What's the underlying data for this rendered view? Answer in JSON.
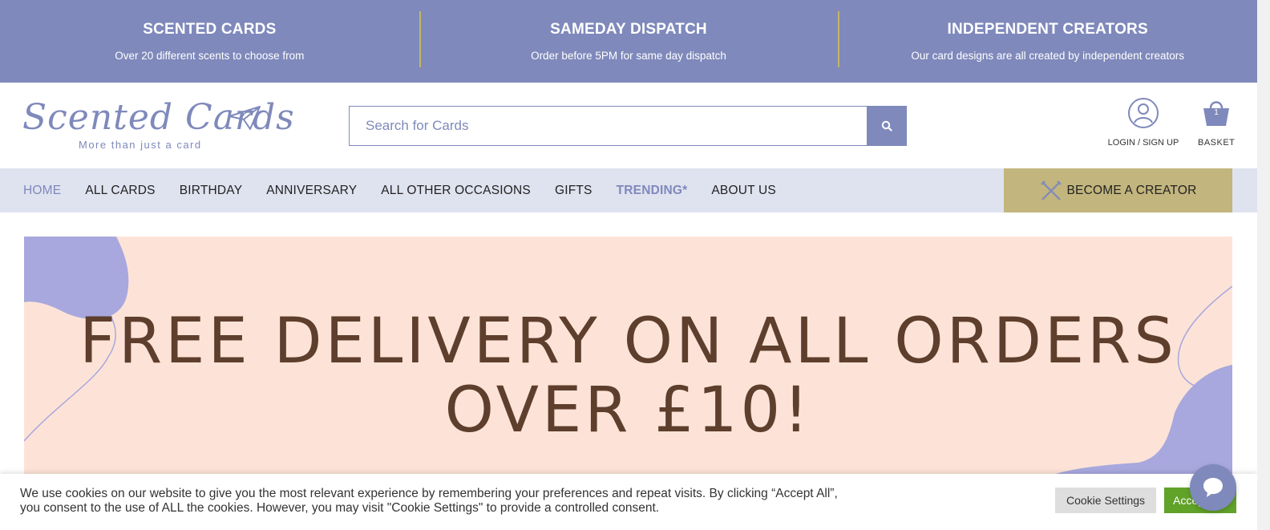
{
  "usp": [
    {
      "title": "SCENTED CARDS",
      "text": "Over 20 different scents to choose from"
    },
    {
      "title": "SAMEDAY DISPATCH",
      "text": "Order before 5PM for same day dispatch"
    },
    {
      "title": "INDEPENDENT CREATORS",
      "text": "Our card designs are all created by independent creators"
    }
  ],
  "header": {
    "logo_name": "Scented Cards",
    "logo_tagline": "More than just a card",
    "search_placeholder": "Search for Cards",
    "account_label": "LOGIN / SIGN UP",
    "basket_label": "BASKET",
    "basket_count": "1"
  },
  "nav": {
    "items": [
      {
        "label": "HOME"
      },
      {
        "label": "ALL CARDS"
      },
      {
        "label": "BIRTHDAY"
      },
      {
        "label": "ANNIVERSARY"
      },
      {
        "label": "ALL OTHER OCCASIONS"
      },
      {
        "label": "GIFTS"
      },
      {
        "label": "TRENDING*"
      },
      {
        "label": "ABOUT US"
      }
    ],
    "creator_label": "BECOME A CREATOR"
  },
  "banner": {
    "line1": "FREE DELIVERY ON ALL ORDERS",
    "line2": "OVER £10!"
  },
  "cookie": {
    "text": "We use cookies on our website to give you the most relevant experience by remembering your preferences and repeat visits. By clicking “Accept All”, you consent to the use of ALL the cookies. However, you may visit \"Cookie Settings\" to provide a controlled consent.",
    "settings_label": "Cookie Settings",
    "accept_label": "Accept All"
  },
  "colors": {
    "brand": "#7f89bb",
    "gold": "#c2b57d",
    "banner_bg": "#fde3d7",
    "banner_text": "#5e3e2c",
    "accept": "#61a229"
  },
  "icons": [
    "search-icon",
    "user-icon",
    "basket-icon",
    "pencil-cross-icon",
    "chat-icon",
    "paper-plane-icon"
  ]
}
